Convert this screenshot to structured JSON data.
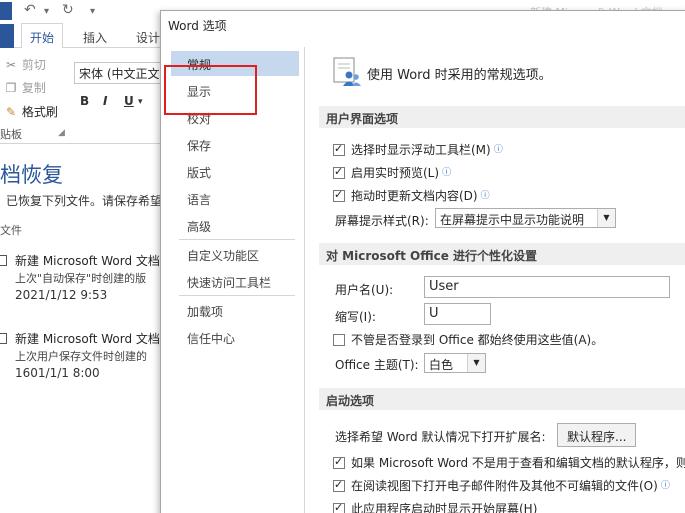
{
  "background": {
    "title_partial": "新建 Microsoft Word 文档",
    "ribbon": {
      "tabs": [
        "开始",
        "插入",
        "设计"
      ],
      "clipboard": {
        "cut": "剪切",
        "copy": "复制",
        "format_painter": "格式刷",
        "group_label": "贴板"
      },
      "font_name": "宋体 (中文正文",
      "format_buttons": [
        "B",
        "I",
        "U"
      ]
    },
    "recovery": {
      "title": "档恢复",
      "subtitle": "已恢复下列文件。请保存希望",
      "list_header": "文件",
      "items": [
        {
          "name": "新建 Microsoft Word 文档",
          "desc": "上次\"自动保存\"时创建的版",
          "time": "2021/1/12 9:53"
        },
        {
          "name": "新建 Microsoft Word 文档",
          "desc": "上次用户保存文件时创建的",
          "time": "1601/1/1 8:00"
        }
      ]
    }
  },
  "dialog": {
    "title": "Word 选项",
    "nav": [
      {
        "label": "常规",
        "selected": true
      },
      {
        "label": "显示"
      },
      {
        "label": "校对"
      },
      {
        "label": "保存"
      },
      {
        "label": "版式"
      },
      {
        "label": "语言"
      },
      {
        "label": "高级"
      },
      {
        "label": "自定义功能区"
      },
      {
        "label": "快速访问工具栏"
      },
      {
        "label": "加载项"
      },
      {
        "label": "信任中心"
      }
    ],
    "intro": "使用 Word 时采用的常规选项。",
    "sections": {
      "ui": {
        "header": "用户界面选项",
        "show_mini_toolbar": "选择时显示浮动工具栏(M)",
        "live_preview": "启用实时预览(L)",
        "update_while_drag": "拖动时更新文档内容(D)",
        "screentip_label": "屏幕提示样式(R):",
        "screentip_value": "在屏幕提示中显示功能说明"
      },
      "personalize": {
        "header": "对 Microsoft Office 进行个性化设置",
        "username_label": "用户名(U):",
        "username_value": "User",
        "initials_label": "缩写(I):",
        "initials_value": "U",
        "always_use": "不管是否登录到 Office 都始终使用这些值(A)。",
        "theme_label": "Office 主题(T):",
        "theme_value": "白色"
      },
      "startup": {
        "header": "启动选项",
        "extensions_label": "选择希望 Word 默认情况下打开扩展名:",
        "default_programs_button": "默认程序...",
        "tell_me": "如果 Microsoft Word 不是用于查看和编辑文档的默认程序，则",
        "open_reading": "在阅读视图下打开电子邮件附件及其他不可编辑的文件(O)",
        "show_start": "此应用程序启动时显示开始屏幕(H)"
      }
    }
  },
  "colors": {
    "accent": "#2b579a",
    "nav_selected": "#c5d8ee",
    "annotation": "#e02020"
  }
}
